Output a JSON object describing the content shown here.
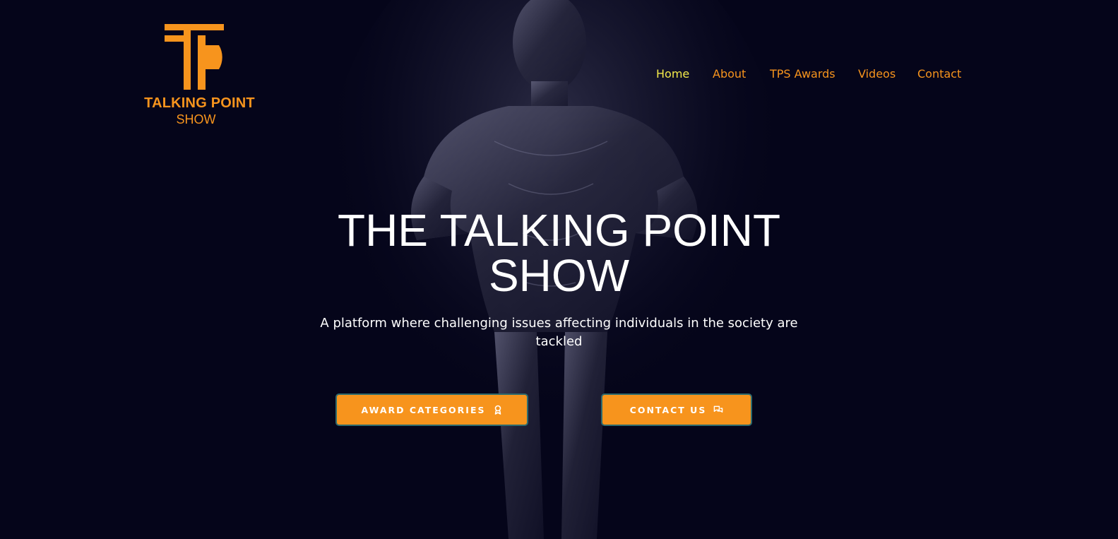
{
  "logo": {
    "line1": "TALKING POINT",
    "line2": "SHOW"
  },
  "nav": {
    "items": [
      {
        "label": "Home",
        "active": true
      },
      {
        "label": "About",
        "active": false
      },
      {
        "label": "TPS Awards",
        "active": false
      },
      {
        "label": "Videos",
        "active": false
      },
      {
        "label": "Contact",
        "active": false
      }
    ]
  },
  "hero": {
    "title_line1": "THE TALKING POINT",
    "title_line2": "SHOW",
    "subtitle": "A platform where challenging issues affecting individuals in the society are tackled",
    "buttons": {
      "awards_label": "AWARD CATEGORIES",
      "awards_icon": "award-icon",
      "contact_label": "CONTACT US",
      "contact_icon": "chat-bubbles-icon"
    }
  },
  "colors": {
    "background": "#05051a",
    "brand_orange": "#f7941d",
    "nav_active": "#f3e94a",
    "button_border": "#2e6b6e"
  }
}
